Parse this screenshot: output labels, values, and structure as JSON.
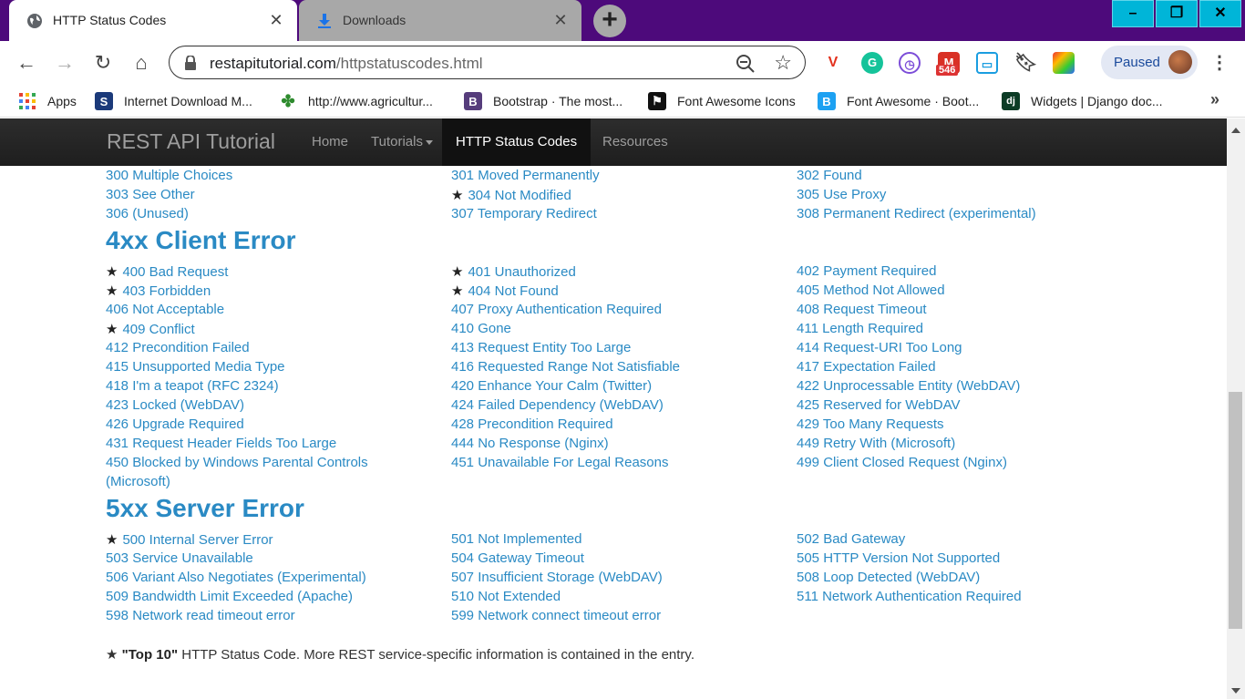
{
  "browser": {
    "tabs": [
      {
        "title": "HTTP Status Codes",
        "icon": "globe-icon"
      },
      {
        "title": "Downloads",
        "icon": "download-icon"
      }
    ],
    "window_buttons": [
      "–",
      "❐",
      "✕"
    ],
    "url_domain": "restapitutorial.com",
    "url_path": "/httpstatuscodes.html",
    "extension_badge": "546",
    "profile_label": "Paused",
    "bookmarks": [
      {
        "label": "Apps",
        "icon": "apps-grid-icon"
      },
      {
        "label": "Internet Download M...",
        "icon": "s-icon"
      },
      {
        "label": "http://www.agricultur...",
        "icon": "plant-icon"
      },
      {
        "label": "Bootstrap · The most...",
        "icon": "bootstrap-icon"
      },
      {
        "label": "Font Awesome Icons",
        "icon": "flag-icon"
      },
      {
        "label": "Font Awesome · Boot...",
        "icon": "b-icon"
      },
      {
        "label": "Widgets | Django doc...",
        "icon": "django-icon"
      }
    ],
    "colors": {
      "tabstrip": "#4d0a7b",
      "window_buttons": "#00b5d8"
    }
  },
  "site": {
    "brand": "REST API Tutorial",
    "nav": [
      "Home",
      "Tutorials",
      "HTTP Status Codes",
      "Resources"
    ],
    "link_color": "#2a8ac4"
  },
  "sections": {
    "s3xx_rows": [
      [
        "300 Multiple Choices",
        "301 Moved Permanently",
        "302 Found"
      ],
      [
        "303 See Other",
        "304 Not Modified",
        "305 Use Proxy"
      ],
      [
        "306 (Unused)",
        "307 Temporary Redirect",
        "308 Permanent Redirect (experimental)"
      ]
    ],
    "s4xx_heading": "4xx Client Error",
    "s4xx_rows": [
      [
        "400 Bad Request",
        "401 Unauthorized",
        "402 Payment Required"
      ],
      [
        "403 Forbidden",
        "404 Not Found",
        "405 Method Not Allowed"
      ],
      [
        "406 Not Acceptable",
        "407 Proxy Authentication Required",
        "408 Request Timeout"
      ],
      [
        "409 Conflict",
        "410 Gone",
        "411 Length Required"
      ],
      [
        "412 Precondition Failed",
        "413 Request Entity Too Large",
        "414 Request-URI Too Long"
      ],
      [
        "415 Unsupported Media Type",
        "416 Requested Range Not Satisfiable",
        "417 Expectation Failed"
      ],
      [
        "418 I'm a teapot (RFC 2324)",
        "420 Enhance Your Calm (Twitter)",
        "422 Unprocessable Entity (WebDAV)"
      ],
      [
        "423 Locked (WebDAV)",
        "424 Failed Dependency (WebDAV)",
        "425 Reserved for WebDAV"
      ],
      [
        "426 Upgrade Required",
        "428 Precondition Required",
        "429 Too Many Requests"
      ],
      [
        "431 Request Header Fields Too Large",
        "444 No Response (Nginx)",
        "449 Retry With (Microsoft)"
      ],
      [
        "450 Blocked by Windows Parental Controls",
        "451 Unavailable For Legal Reasons",
        "499 Client Closed Request (Nginx)"
      ]
    ],
    "s4xx_wrap": "(Microsoft)",
    "s5xx_heading": "5xx Server Error",
    "s5xx_rows": [
      [
        "500 Internal Server Error",
        "501 Not Implemented",
        "502 Bad Gateway"
      ],
      [
        "503 Service Unavailable",
        "504 Gateway Timeout",
        "505 HTTP Version Not Supported"
      ],
      [
        "506 Variant Also Negotiates (Experimental)",
        "507 Insufficient Storage (WebDAV)",
        "508 Loop Detected (WebDAV)"
      ],
      [
        "509 Bandwidth Limit Exceeded (Apache)",
        "510 Not Extended",
        "511 Network Authentication Required"
      ],
      [
        "598 Network read timeout error",
        "599 Network connect timeout error",
        ""
      ]
    ],
    "starred": [
      "304 Not Modified",
      "400 Bad Request",
      "401 Unauthorized",
      "403 Forbidden",
      "404 Not Found",
      "409 Conflict",
      "500 Internal Server Error"
    ]
  },
  "footnote": {
    "star": "★",
    "bold": "\"Top 10\"",
    "text": " HTTP Status Code. More REST service-specific information is contained in the entry."
  }
}
